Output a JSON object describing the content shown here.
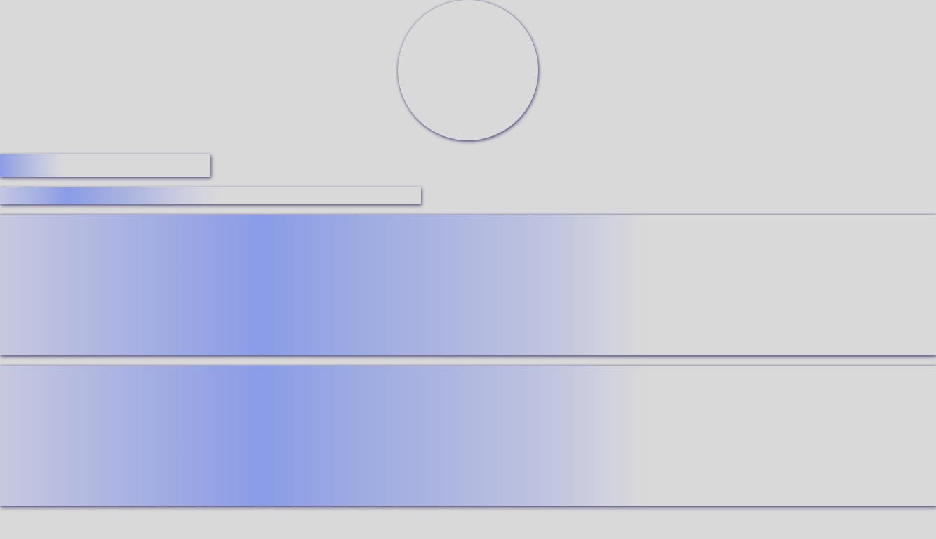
{
  "screen": {
    "background_color": "#d9d9d9",
    "accent_color": "#8a9be8",
    "shadow_color": "#3c376e"
  },
  "elements": {
    "avatar": {
      "shape": "circle",
      "label": ""
    },
    "short_bar": {
      "label": ""
    },
    "medium_bar": {
      "label": ""
    },
    "panel_one": {
      "label": ""
    },
    "panel_two": {
      "label": ""
    }
  }
}
